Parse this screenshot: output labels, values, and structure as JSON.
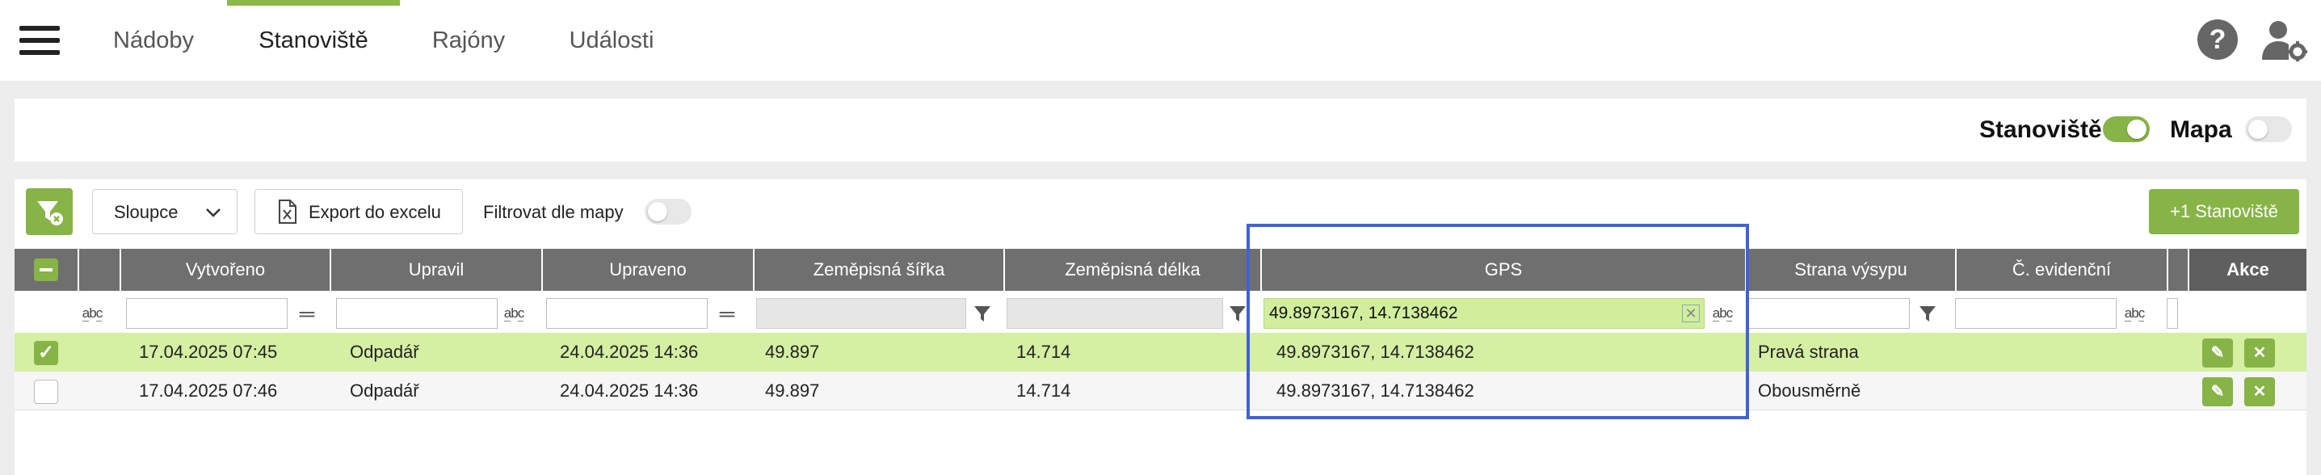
{
  "nav": {
    "tabs": [
      {
        "label": "Nádoby",
        "active": false
      },
      {
        "label": "Stanoviště",
        "active": true
      },
      {
        "label": "Rajóny",
        "active": false
      },
      {
        "label": "Události",
        "active": false
      }
    ],
    "help_icon": "?",
    "accent_color": "#86b446"
  },
  "view_toggle": {
    "stanoviste_label": "Stanoviště",
    "stanoviste_on": true,
    "mapa_label": "Mapa",
    "mapa_on": false
  },
  "toolbar": {
    "columns_label": "Sloupce",
    "export_label": "Export do excelu",
    "filter_map_label": "Filtrovat dle mapy",
    "filter_map_on": false,
    "add_label": "+1 Stanoviště"
  },
  "table": {
    "columns": [
      "Vytvořeno",
      "Upravil",
      "Upraveno",
      "Zeměpisná šířka",
      "Zeměpisná délka",
      "GPS",
      "Strana výsypu",
      "Č. evidenční",
      "Akce"
    ],
    "filters": {
      "gps_value": "49.8973167, 14.7138462"
    },
    "rows": [
      {
        "selected": true,
        "vytvoreno": "17.04.2025 07:45",
        "upravil": "Odpadář",
        "upraveno": "24.04.2025 14:36",
        "sirka": "49.897",
        "delka": "14.714",
        "gps": "49.8973167, 14.7138462",
        "strana": "Pravá strana",
        "evidencni": ""
      },
      {
        "selected": false,
        "vytvoreno": "17.04.2025 07:46",
        "upravil": "Odpadář",
        "upraveno": "24.04.2025 14:36",
        "sirka": "49.897",
        "delka": "14.714",
        "gps": "49.8973167, 14.7138462",
        "strana": "Obousměrně",
        "evidencni": ""
      }
    ]
  }
}
